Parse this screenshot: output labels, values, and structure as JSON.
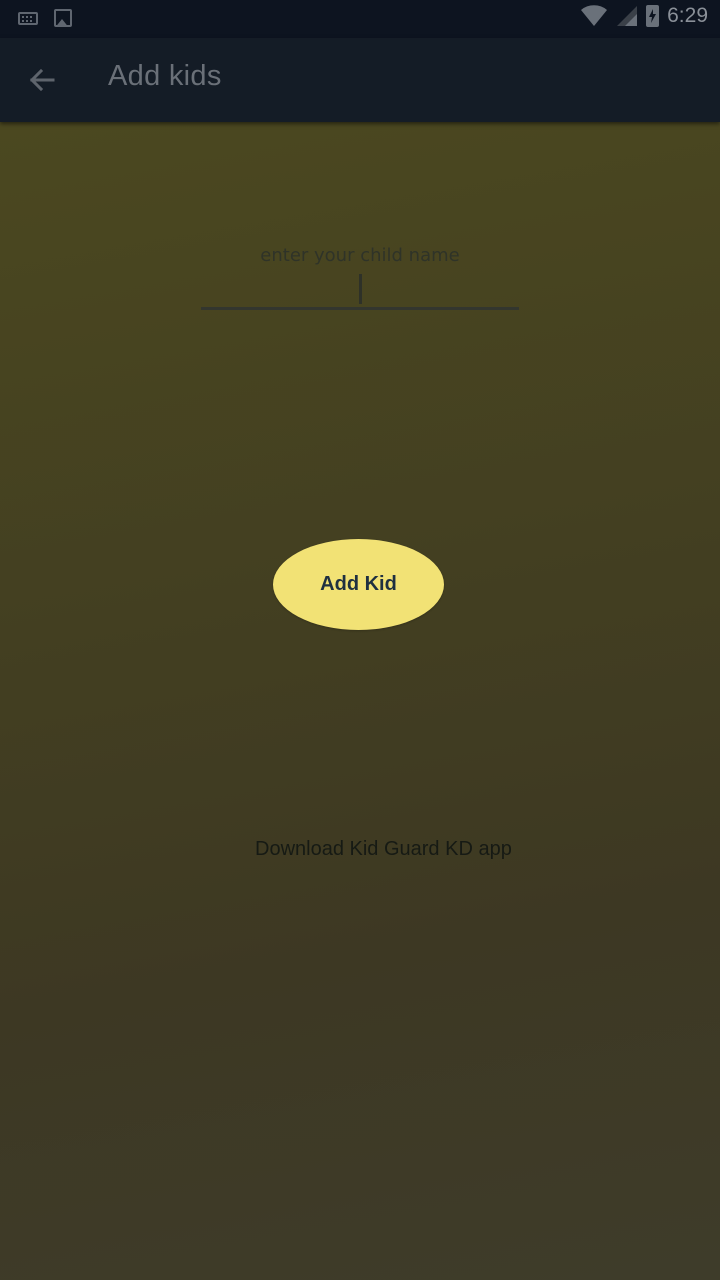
{
  "status_bar": {
    "time": "6:29",
    "icons": [
      "keyboard-icon",
      "image-icon",
      "wifi-icon",
      "cellular-signal-icon",
      "battery-charging-icon"
    ]
  },
  "app_bar": {
    "title": "Add kids",
    "back_icon": "arrow-back-icon"
  },
  "form": {
    "name_placeholder": "enter your child name",
    "name_value": "",
    "add_button_label": "Add Kid",
    "download_link_text": "Download Kid Guard KD app"
  },
  "colors": {
    "status_bar_bg": "#0d1420",
    "app_bar_bg": "#141c26",
    "content_bg": "#443f22",
    "button_bg": "#f2e275",
    "button_text": "#1f3040"
  }
}
